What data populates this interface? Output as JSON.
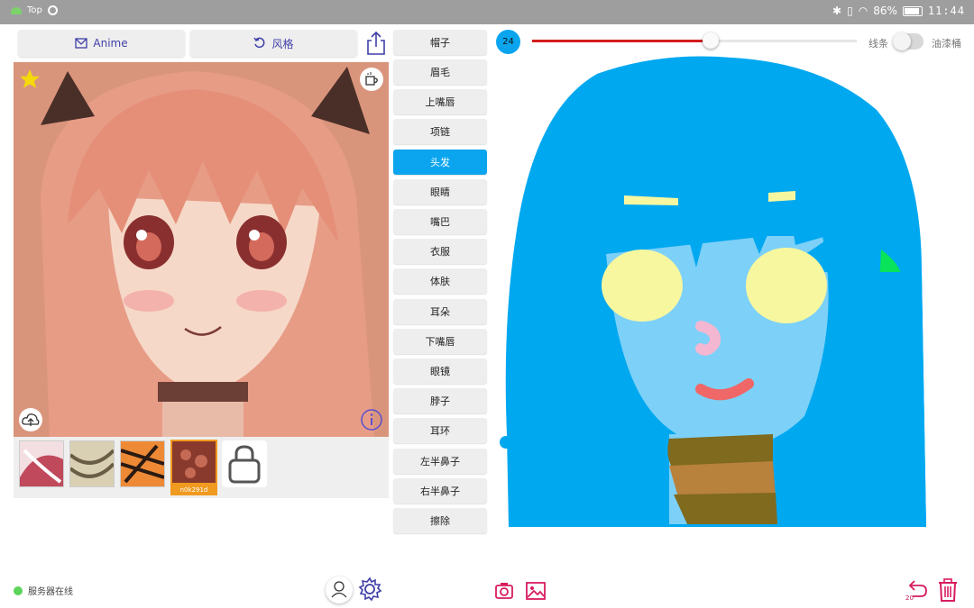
{
  "statusbar": {
    "app_label": "Top",
    "battery": "86%",
    "time": "11:44"
  },
  "toolbar": {
    "anime_label": "Anime",
    "style_label": "风格"
  },
  "thumbnails": [
    {
      "name": "thumb-1",
      "label": ""
    },
    {
      "name": "thumb-2",
      "label": ""
    },
    {
      "name": "thumb-3",
      "label": ""
    },
    {
      "name": "thumb-4",
      "label": "n0k291d",
      "selected": true
    }
  ],
  "parts": [
    "帽子",
    "眉毛",
    "上嘴唇",
    "项链",
    "头发",
    "眼睛",
    "嘴巴",
    "衣服",
    "体肤",
    "耳朵",
    "下嘴唇",
    "眼镜",
    "脖子",
    "耳环",
    "左半鼻子",
    "右半鼻子",
    "擦除"
  ],
  "active_part": "头发",
  "brush": {
    "size": "24",
    "slider_fraction": 0.55,
    "color": "#d41d1d"
  },
  "modes": {
    "line_label": "线条",
    "fill_label": "油漆桶",
    "line_enabled": false
  },
  "server": {
    "status_text": "服务器在线"
  },
  "undo": {
    "count": "20"
  },
  "colors": {
    "accent": "#0aa5ee",
    "hair": "#00a8f0",
    "skin": "#7dd0f7",
    "eyes": "#f7f7a0",
    "lips": "#ef6767",
    "nose": "#f4b7d2",
    "earring": "#08e35a",
    "necklace": "#7f6a1e",
    "icon_pink": "#d81b60"
  }
}
